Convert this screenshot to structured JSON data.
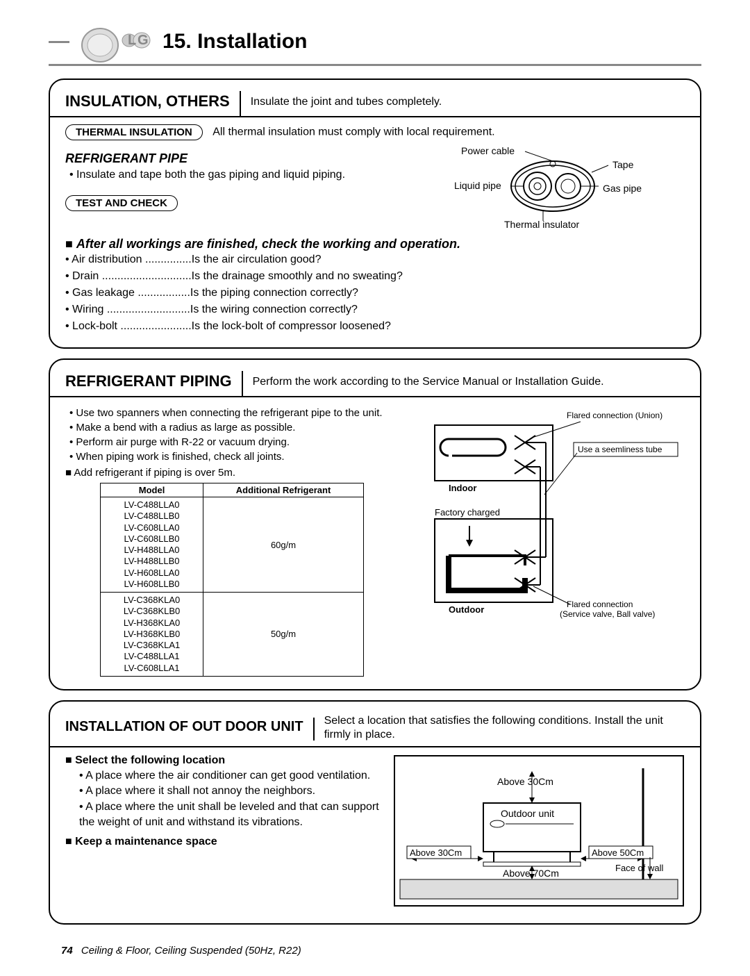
{
  "chapter": {
    "number": "15.",
    "title": "Installation"
  },
  "insulation": {
    "heading": "INSULATION, OTHERS",
    "desc": "Insulate the joint and tubes completely.",
    "thermal_pill": "THERMAL INSULATION",
    "thermal_note": "All thermal insulation must comply with local requirement.",
    "refrigerant_h": "REFRIGERANT PIPE",
    "refrigerant_b1": "Insulate and tape both the gas piping and liquid piping.",
    "test_pill": "TEST AND CHECK",
    "pipe_labels": {
      "power": "Power cable",
      "tape": "Tape",
      "liquid": "Liquid pipe",
      "gas": "Gas pipe",
      "thermal": "Thermal insulator"
    },
    "check_h": "After all workings are finished, check the working and operation.",
    "checks": [
      {
        "label": "Air distribution",
        "dots": "...............",
        "q": "Is the air circulation good?"
      },
      {
        "label": "Drain",
        "dots": ".............................",
        "q": "Is the drainage smoothly and no sweating?"
      },
      {
        "label": "Gas leakage",
        "dots": ".................",
        "q": "Is the piping connection correctly?"
      },
      {
        "label": "Wiring",
        "dots": "...........................",
        "q": "Is the wiring connection correctly?"
      },
      {
        "label": "Lock-bolt",
        "dots": ".......................",
        "q": "Is the lock-bolt of compressor loosened?"
      }
    ]
  },
  "piping": {
    "heading": "REFRIGERANT PIPING",
    "desc": "Perform the work according to the Service Manual or Installation Guide.",
    "bullets": [
      "Use two spanners when connecting the refrigerant pipe to the unit.",
      "Make a bend with a radius as large as possible.",
      "Perform air purge with R-22 or vacuum drying.",
      "When piping work is finished, check all joints."
    ],
    "add_ref": "Add refrigerant if piping is over 5m.",
    "table": {
      "h1": "Model",
      "h2": "Additional Refrigerant",
      "rows": [
        {
          "models": [
            "LV-C488LLA0",
            "LV-C488LLB0",
            "LV-C608LLA0",
            "LV-C608LLB0",
            "LV-H488LLA0",
            "LV-H488LLB0",
            "LV-H608LLA0",
            "LV-H608LLB0"
          ],
          "val": "60g/m"
        },
        {
          "models": [
            "LV-C368KLA0",
            "LV-C368KLB0",
            "LV-H368KLA0",
            "LV-H368KLB0",
            "LV-C368KLA1",
            "LV-C488LLA1",
            "LV-C608LLA1"
          ],
          "val": "50g/m"
        }
      ]
    },
    "diagram": {
      "flared_union": "Flared connection (Union)",
      "seemliness": "Use a seemliness tube",
      "indoor": "Indoor",
      "factory": "Factory charged",
      "outdoor": "Outdoor",
      "flared": "Flared connection",
      "service": "(Service valve, Ball valve)"
    }
  },
  "outdoor": {
    "heading": "INSTALLATION OF OUT DOOR UNIT",
    "desc": "Select a location that satisfies the following conditions. Install the unit firmly in place.",
    "select_h": "Select the following location",
    "select_bullets": [
      "A place where the air conditioner can get good ventilation.",
      "A place where it shall not annoy the neighbors.",
      "A place where the unit shall be leveled and that can support the weight of unit and withstand its vibrations."
    ],
    "keep_h": "Keep a maintenance space",
    "diagram": {
      "above30": "Above 30Cm",
      "unit": "Outdoor unit",
      "above30b": "Above 30Cm",
      "above70": "Above 70Cm",
      "above50": "Above 50Cm",
      "face": "Face of wall"
    }
  },
  "footer": {
    "page": "74",
    "title": "Ceiling & Floor, Ceiling Suspended (50Hz, R22)"
  }
}
